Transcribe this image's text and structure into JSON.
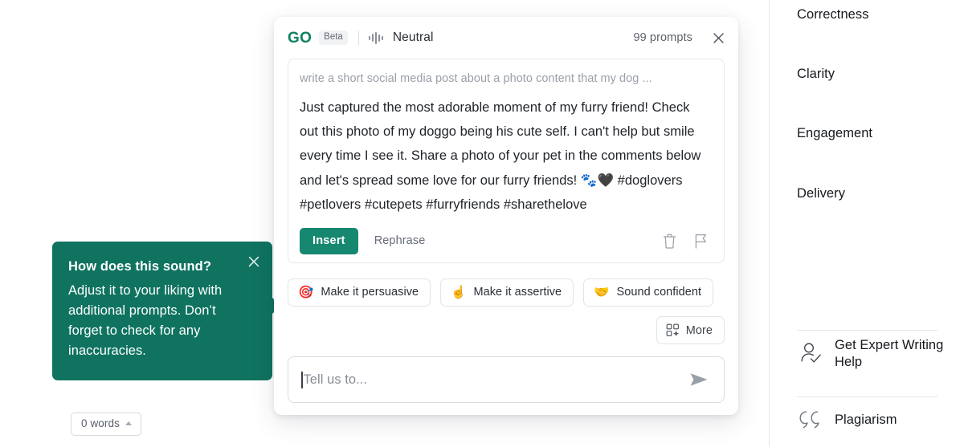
{
  "editor": {
    "word_count": "0 words",
    "word_count_caret_icon": "chevron-up-icon"
  },
  "coachmark": {
    "title": "How does this sound?",
    "body": "Adjust it to your liking with additional prompts. Don’t forget to check for any inaccuracies.",
    "close_icon": "close-icon",
    "background_color": "#0f7360"
  },
  "panel": {
    "header": {
      "logo": "GO",
      "logo_color": "#0f8161",
      "badge": "Beta",
      "tone_icon": "waveform-icon",
      "tone": "Neutral",
      "prompts_remaining": "99 prompts",
      "close_icon": "close-icon"
    },
    "card": {
      "prompt_echo": "write a short social media post about a photo content that my dog ...",
      "generated_text": "Just captured the most adorable moment of my furry friend! Check out this photo of my doggo being his cute self. I can't help but smile every time I see it. Share a photo of your pet in the comments below and let's spread some love for our furry friends! 🐾🖤 #doglovers #petlovers #cutepets #furryfriends #sharethelove",
      "insert_label": "Insert",
      "insert_color": "#16886f",
      "rephrase_label": "Rephrase",
      "delete_icon": "trash-icon",
      "flag_icon": "flag-icon"
    },
    "suggestions": [
      {
        "emoji": "🎯",
        "icon": "dart-icon",
        "label": "Make it persuasive"
      },
      {
        "emoji": "☝️",
        "icon": "pointing-up-icon",
        "label": "Make it assertive"
      },
      {
        "emoji": "🤝",
        "icon": "handshake-icon",
        "label": "Sound confident"
      }
    ],
    "more": {
      "label": "More",
      "icon": "grid-sparkle-icon"
    },
    "input": {
      "value": "",
      "placeholder": "Tell us to...",
      "send_icon": "send-icon"
    }
  },
  "sidebar": {
    "scores": [
      {
        "label": "Correctness"
      },
      {
        "label": "Clarity"
      },
      {
        "label": "Engagement"
      },
      {
        "label": "Delivery"
      }
    ],
    "links": [
      {
        "label": "Get Expert Writing Help",
        "icon": "person-check-icon"
      },
      {
        "label": "Plagiarism",
        "icon": "quotation-marks-icon"
      }
    ]
  }
}
